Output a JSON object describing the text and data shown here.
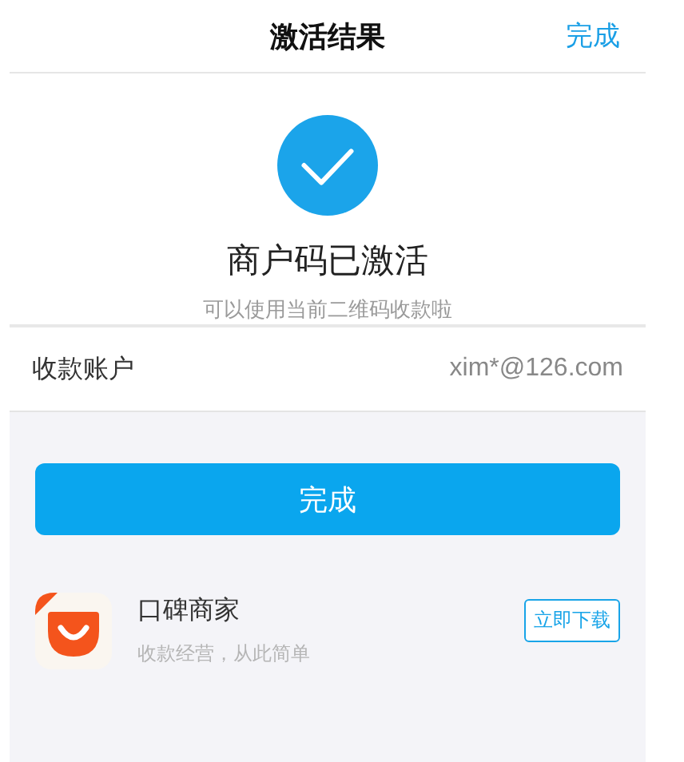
{
  "nav": {
    "title": "激活结果",
    "done": "完成"
  },
  "result": {
    "headline": "商户码已激活",
    "message": "可以使用当前二维码收款啦"
  },
  "account": {
    "label": "收款账户",
    "value": "xim*@126.com"
  },
  "primary_button": "完成",
  "promo": {
    "name": "口碑商家",
    "tagline": "收款经营，从此简单",
    "action": "立即下载"
  }
}
